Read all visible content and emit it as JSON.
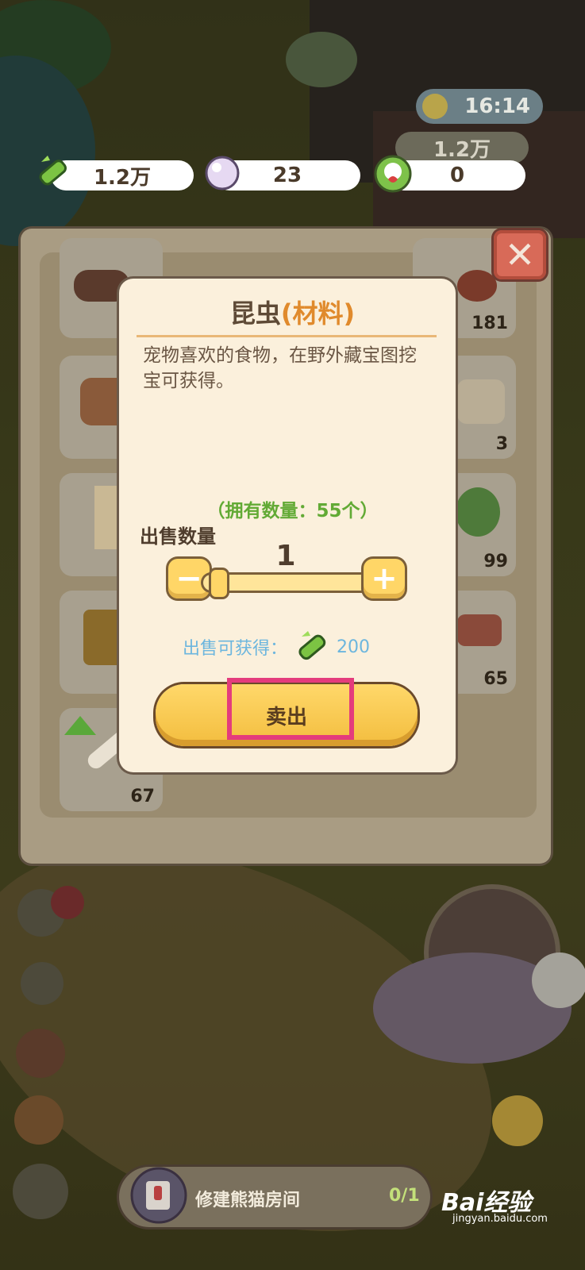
{
  "hud": {
    "time": "16:14",
    "background_currency": "1.2万",
    "resources": [
      {
        "icon": "bamboo-icon",
        "value": "1.2万"
      },
      {
        "icon": "pearl-icon",
        "value": "23"
      },
      {
        "icon": "panda-heart-icon",
        "value": "0"
      }
    ]
  },
  "inventory": {
    "counts": [
      "181",
      "3",
      "99",
      "65",
      "67"
    ]
  },
  "dialog": {
    "title_main": "昆虫",
    "title_sub": "(材料)",
    "description": "宠物喜欢的食物，在野外藏宝图挖宝可获得。",
    "owned_text": "（拥有数量：55个）",
    "sell_quantity_label": "出售数量",
    "quantity": "1",
    "minus_label": "−",
    "plus_label": "+",
    "gain_label": "出售可获得：",
    "gain_value": "200",
    "sell_button": "卖出"
  },
  "close_label": "✕",
  "bottom": {
    "task_label": "修建熊猫房间",
    "task_progress": "0/1"
  },
  "watermark": {
    "logo": "Bai经验",
    "sub": "jingyan.baidu.com"
  },
  "colors": {
    "accent_title": "#e08a2c",
    "owned_green": "#62aa35",
    "gain_blue": "#6cb6de",
    "highlight": "#e43c7c"
  }
}
